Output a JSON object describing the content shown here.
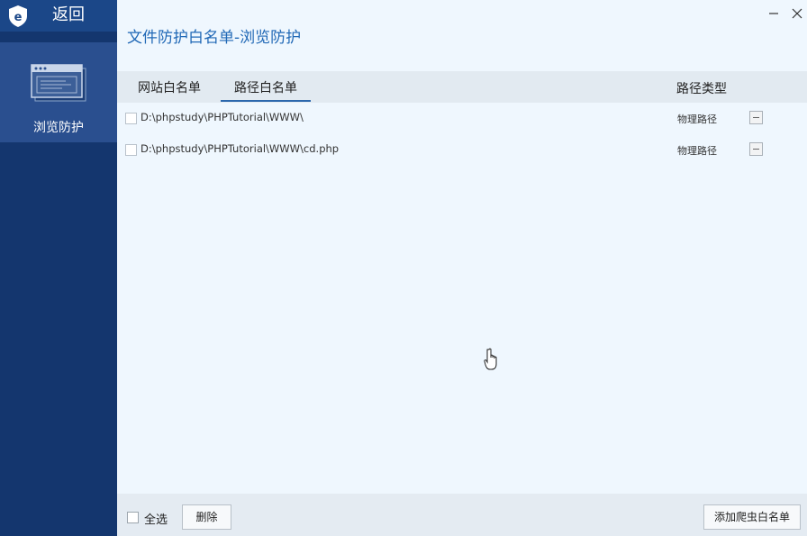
{
  "sidebar": {
    "back_label": "返回",
    "nav_items": [
      {
        "label": "浏览防护",
        "icon": "browser-window-icon",
        "active": true
      }
    ],
    "logo": "shield-e-logo"
  },
  "main": {
    "title": "文件防护白名单-浏览防护",
    "tabs": [
      {
        "label": "网站白名单",
        "active": false
      },
      {
        "label": "路径白名单",
        "active": true
      }
    ],
    "column_type_header": "路径类型",
    "rows": [
      {
        "path": "D:\\phpstudy\\PHPTutorial\\WWW\\",
        "type": "物理路径",
        "checked": false
      },
      {
        "path": "D:\\phpstudy\\PHPTutorial\\WWW\\cd.php",
        "type": "物理路径",
        "checked": false
      }
    ]
  },
  "footer": {
    "select_all_label": "全选",
    "delete_label": "删除",
    "add_label": "添加爬虫白名单"
  },
  "colors": {
    "sidebar_bg": "#14366e",
    "sidebar_active": "#2a4f8f",
    "title_blue": "#2068b6",
    "tab_underline": "#2c68ad"
  }
}
